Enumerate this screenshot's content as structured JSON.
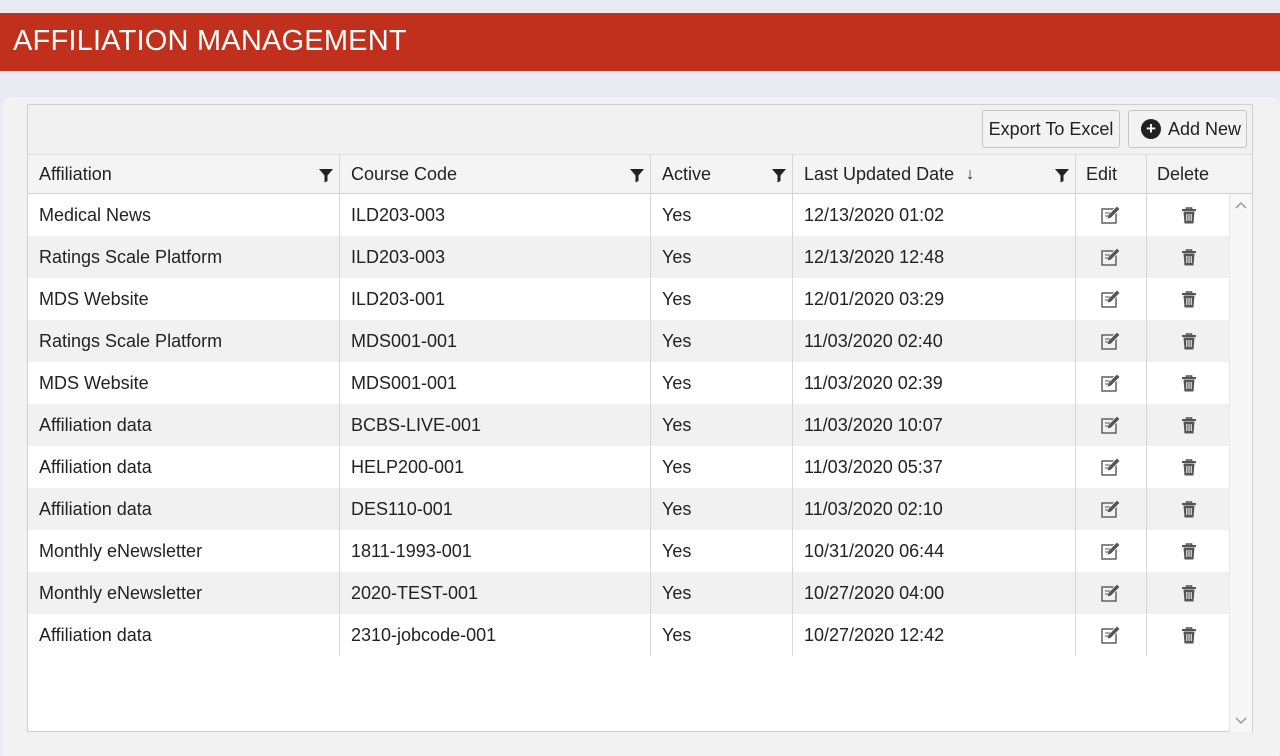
{
  "header": {
    "title": "AFFILIATION MANAGEMENT"
  },
  "toolbar": {
    "export_label": "Export To Excel",
    "add_label": "Add New"
  },
  "columns": {
    "affiliation": "Affiliation",
    "course_code": "Course Code",
    "active": "Active",
    "last_updated": "Last Updated Date",
    "edit": "Edit",
    "delete": "Delete"
  },
  "sort": {
    "column": "Last Updated Date",
    "direction": "descending"
  },
  "rows": [
    {
      "affiliation": "Medical News",
      "course_code": "ILD203-003",
      "active": "Yes",
      "last_updated": "12/13/2020 01:02"
    },
    {
      "affiliation": "Ratings Scale Platform",
      "course_code": "ILD203-003",
      "active": "Yes",
      "last_updated": "12/13/2020 12:48"
    },
    {
      "affiliation": "MDS Website",
      "course_code": "ILD203-001",
      "active": "Yes",
      "last_updated": "12/01/2020 03:29"
    },
    {
      "affiliation": "Ratings Scale Platform",
      "course_code": "MDS001-001",
      "active": "Yes",
      "last_updated": "11/03/2020 02:40"
    },
    {
      "affiliation": "MDS Website",
      "course_code": "MDS001-001",
      "active": "Yes",
      "last_updated": "11/03/2020 02:39"
    },
    {
      "affiliation": "Affiliation data",
      "course_code": "BCBS-LIVE-001",
      "active": "Yes",
      "last_updated": "11/03/2020 10:07"
    },
    {
      "affiliation": "Affiliation data",
      "course_code": "HELP200-001",
      "active": "Yes",
      "last_updated": "11/03/2020 05:37"
    },
    {
      "affiliation": "Affiliation data",
      "course_code": "DES110-001",
      "active": "Yes",
      "last_updated": "11/03/2020 02:10"
    },
    {
      "affiliation": "Monthly eNewsletter",
      "course_code": "1811-1993-001",
      "active": "Yes",
      "last_updated": "10/31/2020 06:44"
    },
    {
      "affiliation": "Monthly eNewsletter",
      "course_code": "2020-TEST-001",
      "active": "Yes",
      "last_updated": "10/27/2020 04:00"
    },
    {
      "affiliation": "Affiliation data",
      "course_code": "2310-jobcode-001",
      "active": "Yes",
      "last_updated": "10/27/2020 12:42"
    }
  ],
  "icons": {
    "filter": "filter-icon",
    "sort": "sort-descending-arrow-icon",
    "edit": "edit-pencil-icon",
    "delete": "trash-icon",
    "add": "plus-circle-icon"
  },
  "colors": {
    "header_bg": "#c0301d",
    "header_text": "#ffffff",
    "row_alt": "#f1f1f1"
  }
}
